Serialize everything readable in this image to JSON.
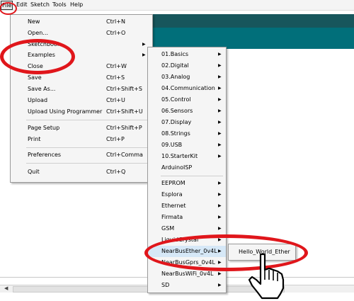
{
  "menubar": {
    "items": [
      {
        "label": "File"
      },
      {
        "label": "Edit"
      },
      {
        "label": "Sketch"
      },
      {
        "label": "Tools"
      },
      {
        "label": "Help"
      }
    ]
  },
  "file_menu": {
    "items": [
      {
        "label": "New",
        "shortcut": "Ctrl+N"
      },
      {
        "label": "Open...",
        "shortcut": "Ctrl+O"
      },
      {
        "label": "Sketchbook",
        "shortcut": ""
      },
      {
        "label": "Examples",
        "shortcut": ""
      },
      {
        "label": "Close",
        "shortcut": "Ctrl+W"
      },
      {
        "label": "Save",
        "shortcut": "Ctrl+S"
      },
      {
        "label": "Save As...",
        "shortcut": "Ctrl+Shift+S"
      },
      {
        "label": "Upload",
        "shortcut": "Ctrl+U"
      },
      {
        "label": "Upload Using Programmer",
        "shortcut": "Ctrl+Shift+U"
      },
      {
        "label": "Page Setup",
        "shortcut": "Ctrl+Shift+P"
      },
      {
        "label": "Print",
        "shortcut": "Ctrl+P"
      },
      {
        "label": "Preferences",
        "shortcut": "Ctrl+Comma"
      },
      {
        "label": "Quit",
        "shortcut": "Ctrl+Q"
      }
    ]
  },
  "examples_menu": {
    "items": [
      {
        "label": "01.Basics"
      },
      {
        "label": "02.Digital"
      },
      {
        "label": "03.Analog"
      },
      {
        "label": "04.Communication"
      },
      {
        "label": "05.Control"
      },
      {
        "label": "06.Sensors"
      },
      {
        "label": "07.Display"
      },
      {
        "label": "08.Strings"
      },
      {
        "label": "09.USB"
      },
      {
        "label": "10.StarterKit"
      },
      {
        "label": "ArduinoISP"
      },
      {
        "label": "EEPROM"
      },
      {
        "label": "Esplora"
      },
      {
        "label": "Ethernet"
      },
      {
        "label": "Firmata"
      },
      {
        "label": "GSM"
      },
      {
        "label": "LiquidCrystal"
      },
      {
        "label": "NearBusEther_0v4L"
      },
      {
        "label": "NearBusGprs_0v4L"
      },
      {
        "label": "NearBusWiFi_0v4L"
      },
      {
        "label": "SD"
      }
    ]
  },
  "nearbus_submenu": {
    "items": [
      {
        "label": "Hello_World_Ether"
      }
    ]
  },
  "colors": {
    "highlight_ring": "#e0161b",
    "editor_header_dark": "#17565c",
    "editor_header_teal": "#016f7a"
  },
  "icons": {
    "cursor": "hand-pointer-icon",
    "submenu": "triangle-right-icon",
    "scroll_left": "triangle-left-icon"
  }
}
